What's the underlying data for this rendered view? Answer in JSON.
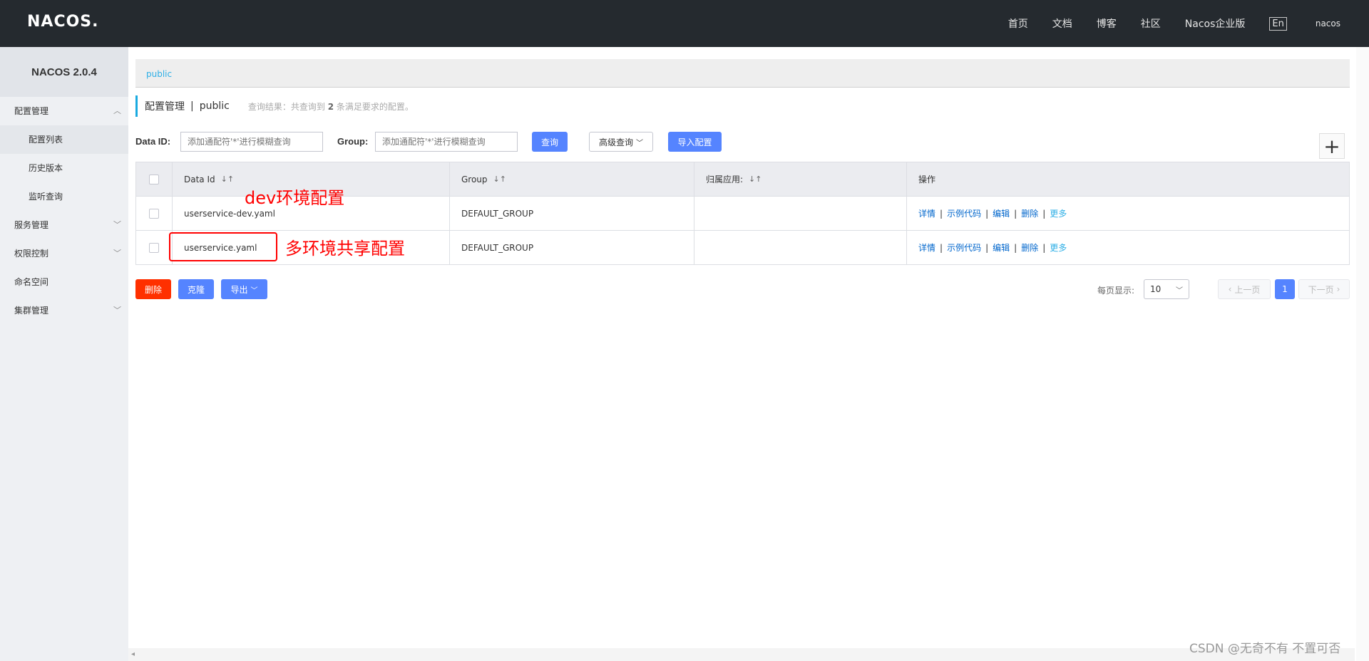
{
  "header": {
    "logo": "NACOS.",
    "nav": [
      "首页",
      "文档",
      "博客",
      "社区",
      "Nacos企业版"
    ],
    "lang": "En",
    "user": "nacos"
  },
  "sidebar": {
    "version": "NACOS 2.0.4",
    "config_mgmt": "配置管理",
    "config_sub": [
      "配置列表",
      "历史版本",
      "监听查询"
    ],
    "service_mgmt": "服务管理",
    "auth": "权限控制",
    "namespace": "命名空间",
    "cluster": "集群管理"
  },
  "breadcrumb": {
    "namespace": "public"
  },
  "title": {
    "main": "配置管理",
    "sep": "|",
    "namespace": "public",
    "result_prefix": "查询结果：共查询到",
    "result_count": "2",
    "result_suffix": "条满足要求的配置。"
  },
  "search": {
    "dataid_label": "Data ID:",
    "dataid_placeholder": "添加通配符'*'进行模糊查询",
    "group_label": "Group:",
    "group_placeholder": "添加通配符'*'进行模糊查询",
    "query_btn": "查询",
    "advanced_btn": "高级查询",
    "import_btn": "导入配置",
    "add_btn": "+"
  },
  "table": {
    "columns": [
      "Data Id",
      "Group",
      "归属应用:",
      "操作"
    ],
    "rows": [
      {
        "data_id": "userservice-dev.yaml",
        "group": "DEFAULT_GROUP",
        "app": ""
      },
      {
        "data_id": "userservice.yaml",
        "group": "DEFAULT_GROUP",
        "app": ""
      }
    ],
    "ops": {
      "detail": "详情",
      "sample": "示例代码",
      "edit": "编辑",
      "delete": "删除",
      "more": "更多"
    }
  },
  "annotations": {
    "dev": "dev环境配置",
    "shared": "多环境共享配置"
  },
  "bulk": {
    "delete": "删除",
    "clone": "克隆",
    "export": "导出"
  },
  "pager": {
    "per_page_label": "每页显示:",
    "per_page": "10",
    "prev": "上一页",
    "current": "1",
    "next": "下一页"
  },
  "watermark": "CSDN @无奇不有 不置可否",
  "colors": {
    "topbar": "#252a2f",
    "primary": "#5584ff",
    "danger": "#ff3000",
    "link": "#0066cc",
    "annotation": "#ff0000"
  }
}
